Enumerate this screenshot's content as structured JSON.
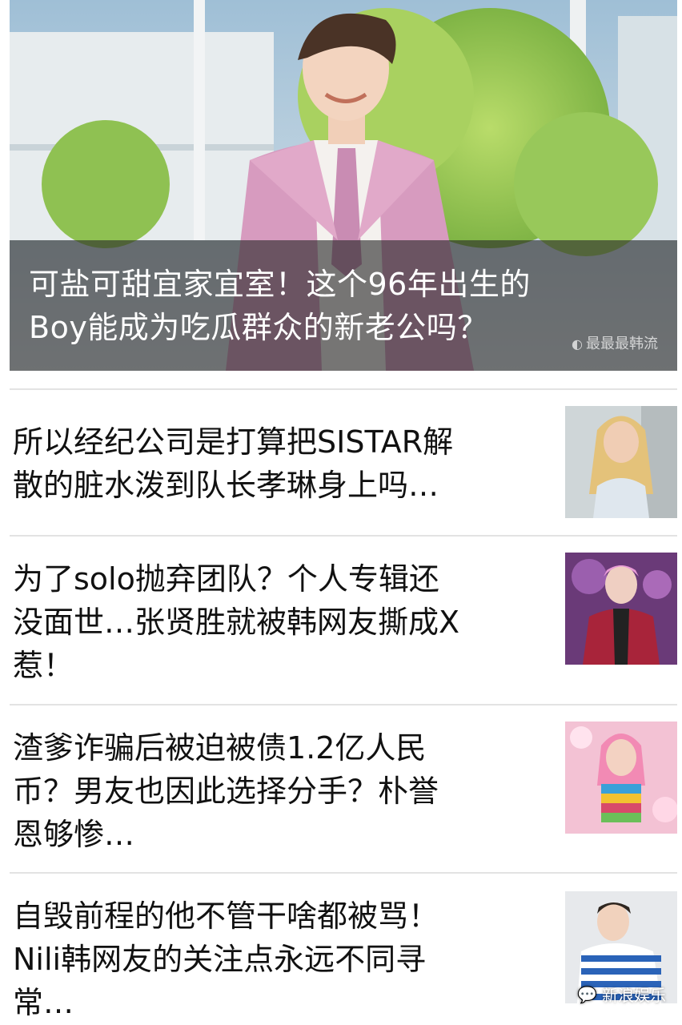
{
  "hero": {
    "title_line1": "可盐可甜宜家宜室！这个96年出生的",
    "title_line2": "Boy能成为吃瓜群众的新老公吗？",
    "watermark": "最最最韩流",
    "image_icon": "photo-man-pink-suit-icon"
  },
  "articles": [
    {
      "title_lines": [
        "所以经纪公司是打算把SISTAR解",
        "散的脏水泼到队长孝琳身上吗…"
      ],
      "thumb_icon": "photo-blonde-woman-icon"
    },
    {
      "title_lines": [
        "为了solo抛弃团队？个人专辑还",
        "没面世…张贤胜就被韩网友撕成X",
        "惹！"
      ],
      "thumb_icon": "photo-man-plaid-jacket-icon"
    },
    {
      "title_lines": [
        "渣爹诈骗后被迫被债1.2亿人民",
        "币？男友也因此选择分手？朴誉",
        "恩够惨…"
      ],
      "thumb_icon": "photo-pink-hair-woman-icon"
    },
    {
      "title_lines": [
        "自毁前程的他不管干啥都被骂！",
        "Nili韩网友的关注点永远不同寻",
        "常…"
      ],
      "thumb_icon": "photo-man-striped-sweater-icon"
    }
  ],
  "footer": {
    "badge_text": "新浪娱乐",
    "badge_icon": "wechat-icon"
  }
}
